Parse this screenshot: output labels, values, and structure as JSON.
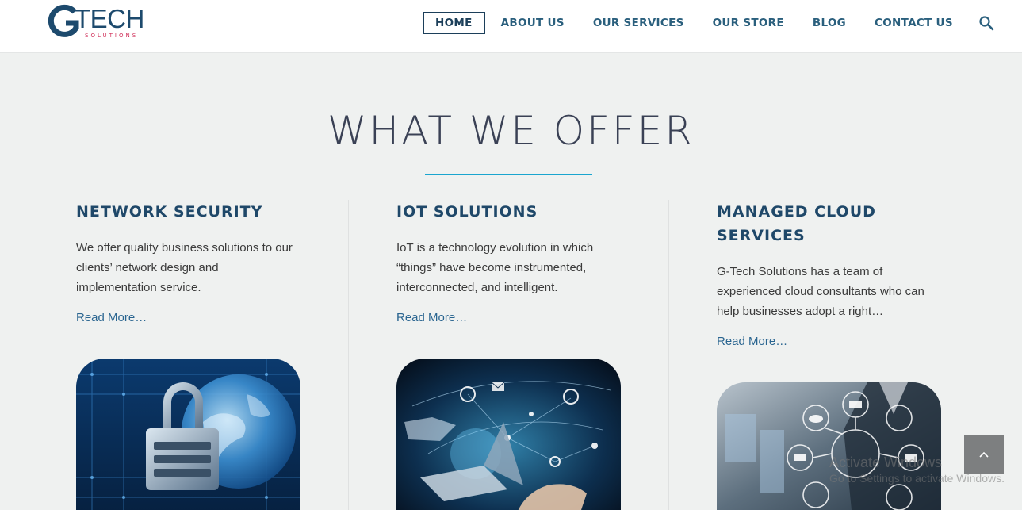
{
  "header": {
    "logo_text": "TECH",
    "logo_sub": "SOLUTIONS",
    "brand_colors": {
      "primary": "#1d4a6d",
      "accent": "#d0305a"
    }
  },
  "nav": {
    "items": [
      {
        "label": "HOME",
        "active": true
      },
      {
        "label": "ABOUT US"
      },
      {
        "label": "OUR SERVICES"
      },
      {
        "label": "OUR STORE"
      },
      {
        "label": "BLOG"
      },
      {
        "label": "CONTACT US"
      }
    ],
    "search_icon": "search-icon"
  },
  "main": {
    "title": "WHAT WE OFFER",
    "accent_color": "#1aa5cf",
    "cards": [
      {
        "title_lines": [
          "NETWORK SECURITY"
        ],
        "desc_lines": [
          "We offer quality business solutions to our",
          "clients’ network design and",
          "implementation service."
        ],
        "link": "Read More…",
        "image": "padlock-globe-image"
      },
      {
        "title_lines": [
          "IOT SOLUTIONS"
        ],
        "desc_lines": [
          "IoT is a technology evolution in which",
          "“things” have become instrumented,",
          "interconnected, and intelligent."
        ],
        "link": "Read More…",
        "image": "iot-hand-laptop-image"
      },
      {
        "title_lines": [
          "MANAGED CLOUD",
          "SERVICES"
        ],
        "desc_lines": [
          "G-Tech Solutions has a team of",
          "experienced cloud consultants who can",
          "help businesses adopt a right…"
        ],
        "link": "Read More…",
        "image": "cloud-network-man-image"
      }
    ]
  },
  "scroll_top_icon": "chevron-up-icon",
  "watermark": {
    "line1": "Activate Windows",
    "line2": "Go to Settings to activate Windows."
  }
}
